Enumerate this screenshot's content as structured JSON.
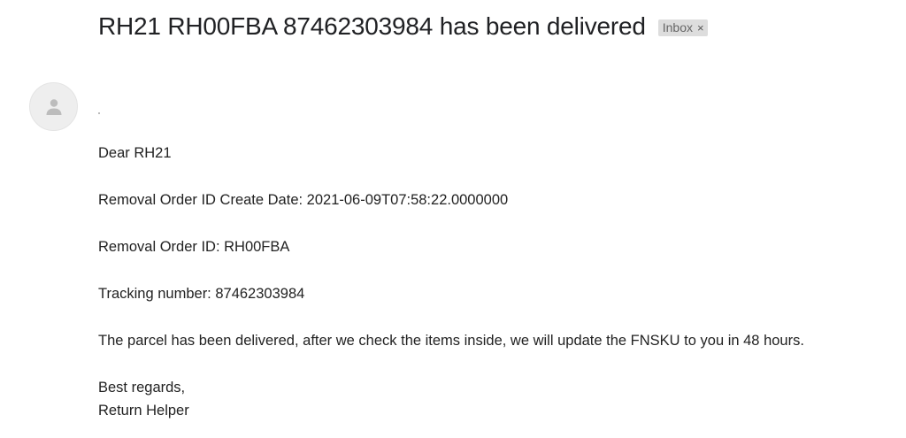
{
  "email": {
    "subject": "RH21 RH00FBA 87462303984 has been delivered",
    "label": "Inbox",
    "label_remove": "×",
    "avatar_icon": "person-icon",
    "body": {
      "greeting": "Dear RH21",
      "create_date_line": "Removal Order ID Create Date: 2021-06-09T07:58:22.0000000",
      "order_id_line": "Removal Order ID: RH00FBA",
      "tracking_line": "Tracking number: 87462303984",
      "message": "The parcel has been delivered, after we check the items inside, we will update the FNSKU to you in 48 hours.",
      "closing": "Best regards,",
      "signature": "Return Helper"
    }
  }
}
